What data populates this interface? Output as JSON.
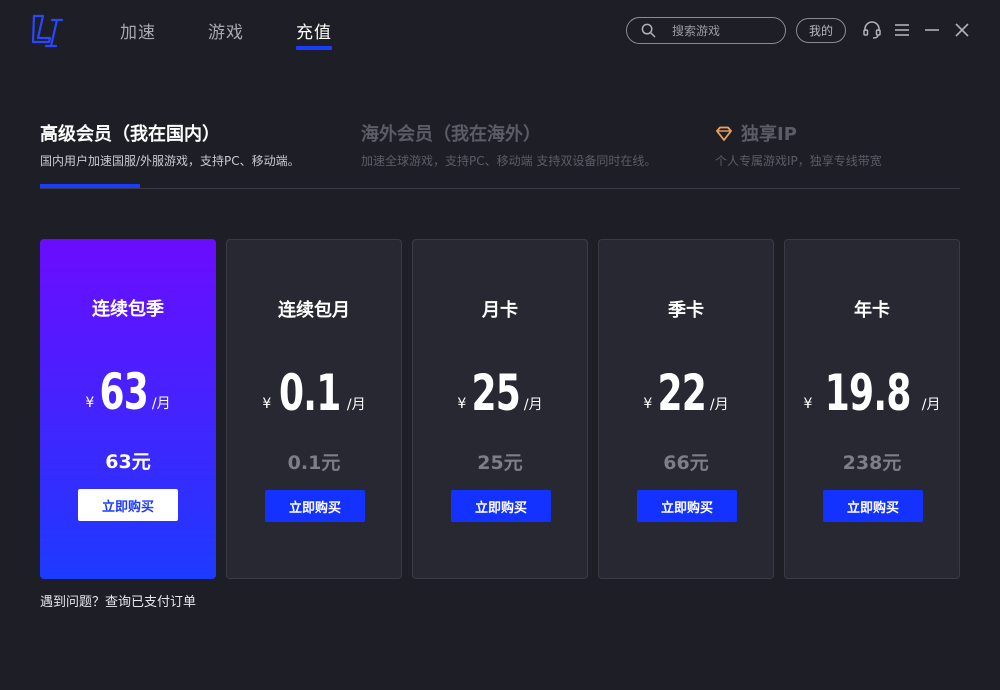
{
  "nav": {
    "items": [
      {
        "label": "加速",
        "active": false
      },
      {
        "label": "游戏",
        "active": false
      },
      {
        "label": "充值",
        "active": true
      }
    ]
  },
  "search": {
    "placeholder": "搜索游戏",
    "icon": "search-icon"
  },
  "header": {
    "mine_label": "我的",
    "icons": [
      "headset-icon",
      "menu-icon",
      "minimize-icon",
      "close-icon"
    ]
  },
  "tabs": [
    {
      "title": "高级会员（我在国内）",
      "subtitle": "国内用户加速国服/外服游戏，支持PC、移动端。",
      "active": true
    },
    {
      "title": "海外会员（我在海外）",
      "subtitle": "加速全球游戏，支持PC、移动端 支持双设备同时在线。",
      "active": false
    },
    {
      "title": "独享IP",
      "subtitle": "个人专属游戏IP，独享专线带宽",
      "active": false,
      "icon": "diamond-icon"
    }
  ],
  "plans": [
    {
      "name": "连续包季",
      "currency": "¥",
      "amount": "63",
      "unit": "/月",
      "total": "63元",
      "button": "立即购买",
      "featured": true
    },
    {
      "name": "连续包月",
      "currency": "¥",
      "amount": "0.1",
      "unit": "/月",
      "total": "0.1元",
      "button": "立即购买",
      "featured": false
    },
    {
      "name": "月卡",
      "currency": "¥",
      "amount": "25",
      "unit": "/月",
      "total": "25元",
      "button": "立即购买",
      "featured": false
    },
    {
      "name": "季卡",
      "currency": "¥",
      "amount": "22",
      "unit": "/月",
      "total": "66元",
      "button": "立即购买",
      "featured": false
    },
    {
      "name": "年卡",
      "currency": "¥",
      "amount": "19.8",
      "unit": "/月",
      "total": "238元",
      "button": "立即购买",
      "featured": false
    }
  ],
  "help_text": "遇到问题？查询已支付订单",
  "colors": {
    "accent": "#1a3cff",
    "featured_top": "#6b0cff",
    "featured_bottom": "#1d3aff",
    "background": "#1e1f26"
  }
}
